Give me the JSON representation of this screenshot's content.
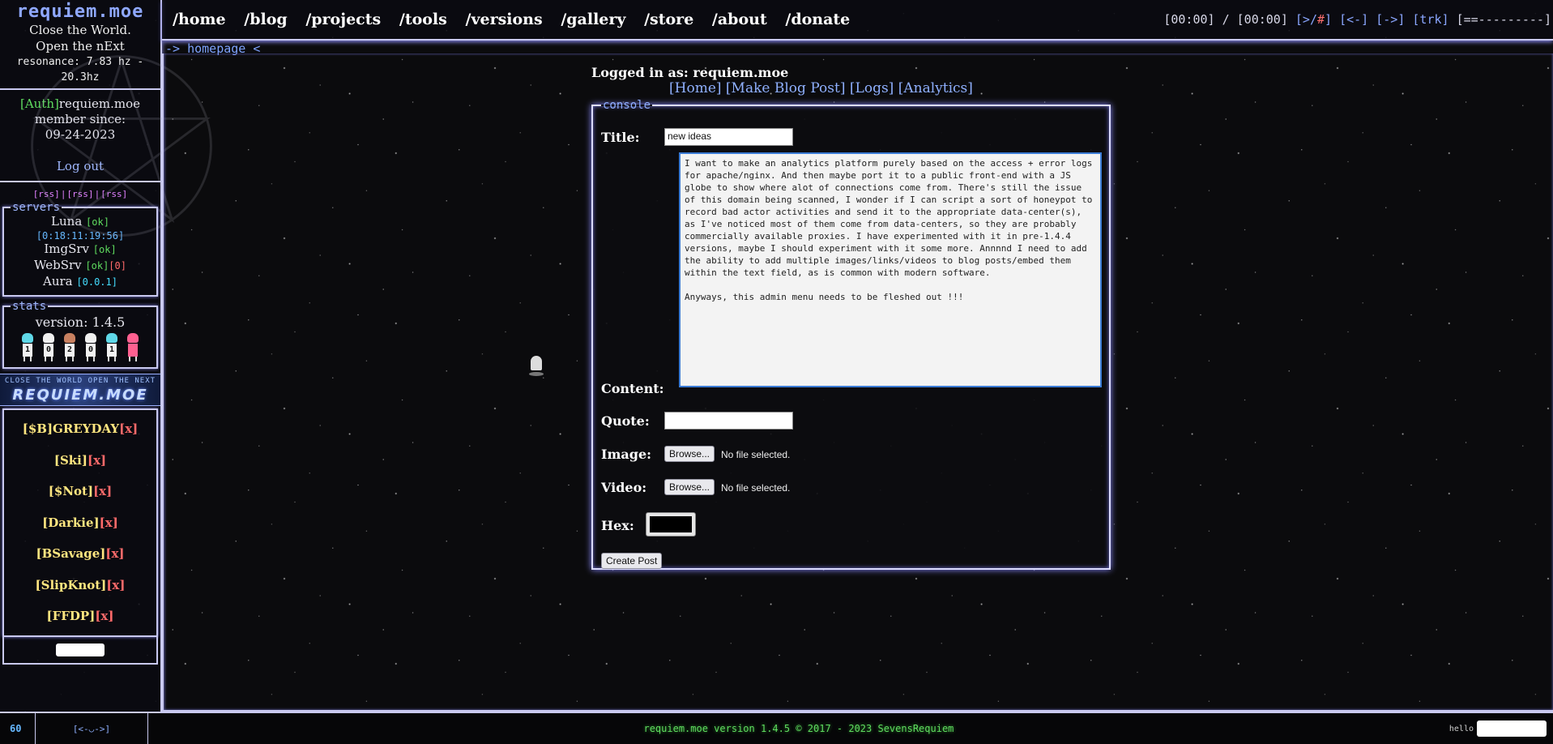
{
  "sidebar": {
    "brand_title": "requiem.moe",
    "tagline_1": "Close the World.",
    "tagline_2": "Open the nExt",
    "resonance": "resonance: 7.83 hz - 20.3hz",
    "auth_tag": "[Auth]",
    "auth_user": "requiem.moe",
    "member_since_label": "member since:",
    "member_since_date": "09-24-2023",
    "logout_label": "Log out",
    "rss": [
      "[rss]",
      "[rss]",
      "[rss]"
    ],
    "servers_legend": "servers",
    "servers": [
      {
        "name": "Luna",
        "status": "[ok]"
      },
      {
        "name": "ImgSrv",
        "status": "[ok]"
      },
      {
        "name": "WebSrv",
        "status": "[ok]",
        "extra": "[0]"
      },
      {
        "name": "Aura",
        "status": "[0.0.1]"
      }
    ],
    "luna_uptime": "[0:18:11:19:56]",
    "stats_legend": "stats",
    "version_label": "version: 1.4.5",
    "counter_digits": [
      "1",
      "0",
      "2",
      "0",
      "1",
      ""
    ],
    "banner_small": "CLOSE THE WORLD OPEN THE NEXT",
    "banner_big": "REQUIEM.MOE",
    "bands": [
      {
        "name": "[$B]GREYDAY",
        "x": "[x]"
      },
      {
        "name": "[Ski]",
        "x": "[x]"
      },
      {
        "name": "[$Not]",
        "x": "[x]"
      },
      {
        "name": "[Darkie]",
        "x": "[x]"
      },
      {
        "name": "[BSavage]",
        "x": "[x]"
      },
      {
        "name": "[SlipKnot]",
        "x": "[x]"
      },
      {
        "name": "[FFDP]",
        "x": "[x]"
      }
    ]
  },
  "nav": {
    "items": [
      "/home",
      "/blog",
      "/projects",
      "/tools",
      "/versions",
      "/gallery",
      "/store",
      "/about",
      "/donate"
    ],
    "player_time": "[00:00] / [00:00]",
    "player_play_open": "[>/",
    "player_play_hash": "#",
    "player_play_close": "]",
    "player_prev": "[<-]",
    "player_next": "[->]",
    "player_trk": "[trk]",
    "player_bar": "[==---------]"
  },
  "breadcrumb": "-> homepage <",
  "login": {
    "text": "Logged in as: requiem.moe",
    "links": [
      "[Home]",
      "[Make Blog Post]",
      "[Logs]",
      "[Analytics]"
    ]
  },
  "console": {
    "legend": "console",
    "title_label": "Title:",
    "title_value": "new ideas",
    "content_label": "Content:",
    "content_value": "I want to make an analytics platform purely based on the access + error logs for apache/nginx. And then maybe port it to a public front-end with a JS globe to show where alot of connections come from. There's still the issue of this domain being scanned, I wonder if I can script a sort of honeypot to record bad actor activities and send it to the appropriate data-center(s), as I've noticed most of them come from data-centers, so they are probably commercially available proxies. I have experimented with it in pre-1.4.4 versions, maybe I should experiment with it some more. Annnnd I need to add the ability to add multiple images/links/videos to blog posts/embed them within the text field, as is common with modern software.\n\nAnyways, this admin menu needs to be fleshed out !!!",
    "quote_label": "Quote:",
    "quote_value": "",
    "image_label": "Image:",
    "video_label": "Video:",
    "browse_label": "Browse...",
    "no_file": "No file selected.",
    "hex_label": "Hex:",
    "hex_color": "#000000",
    "create_label": "Create Post"
  },
  "footer": {
    "fps": "60",
    "face": "[<-◡->]",
    "copyright": "requiem.moe version 1.4.5 © 2017 - 2023 SevensRequiem",
    "hello": "hello"
  },
  "colors": {
    "accent_blue": "#8fb0ff",
    "ok_green": "#5fdc5f",
    "error_red": "#ff6a6a",
    "band_yellow": "#ffe680",
    "frame": "#c9c9f0"
  }
}
